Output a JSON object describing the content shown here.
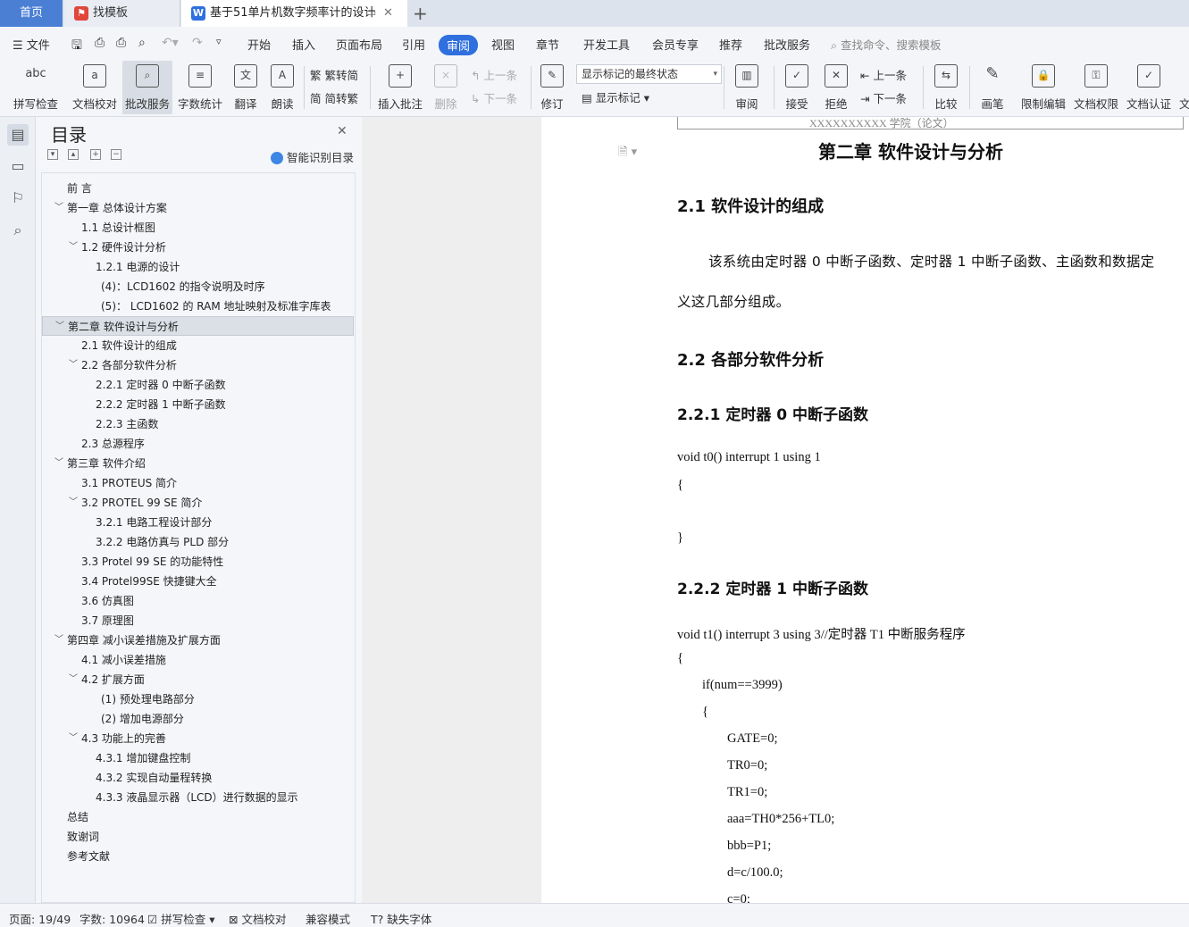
{
  "tabs": {
    "home": "首页",
    "template": "找模板",
    "document": "基于51单片机数字频率计的设计"
  },
  "menu": {
    "file": "文件",
    "items": [
      "开始",
      "插入",
      "页面布局",
      "引用",
      "审阅",
      "视图",
      "章节",
      "开发工具",
      "会员专享",
      "推荐",
      "批改服务"
    ],
    "active": "审阅",
    "search_placeholder": "查找命令、搜索模板"
  },
  "ribbon": {
    "spellcheck": "拼写检查",
    "doc_proof": "文档校对",
    "approval": "批改服务",
    "word_count": "字数统计",
    "translate": "翻译",
    "read_aloud": "朗读",
    "trad_conv": "繁转简",
    "simp_conv": "简转繁",
    "insert_comment": "插入批注",
    "delete": "删除",
    "prev": "上一条",
    "next": "下一条",
    "revise": "修订",
    "markup_state": "显示标记的最终状态",
    "show_markup": "显示标记",
    "review": "审阅",
    "accept": "接受",
    "reject": "拒绝",
    "prev2": "上一条",
    "next2": "下一条",
    "compare": "比较",
    "pen": "画笔",
    "restrict_edit": "限制编辑",
    "doc_perm": "文档权限",
    "doc_cert": "文档认证",
    "more": "文"
  },
  "toc": {
    "title": "目录",
    "smart": "智能识别目录",
    "items": [
      {
        "text": "前    言",
        "level": 0,
        "chevron": false
      },
      {
        "text": "第一章    总体设计方案",
        "level": 0,
        "chevron": true
      },
      {
        "text": "1.1  总设计框图",
        "level": 1,
        "chevron": false
      },
      {
        "text": "1.2   硬件设计分析",
        "level": 1,
        "chevron": true
      },
      {
        "text": "1.2.1  电源的设计",
        "level": 2,
        "chevron": false
      },
      {
        "text": "(4)：LCD1602 的指令说明及时序",
        "level": 3,
        "chevron": false
      },
      {
        "text": "(5)：   LCD1602 的 RAM 地址映射及标准字库表",
        "level": 3,
        "chevron": false
      },
      {
        "text": "第二章    软件设计与分析",
        "level": 0,
        "chevron": true,
        "selected": true
      },
      {
        "text": "2.1  软件设计的组成",
        "level": 1,
        "chevron": false
      },
      {
        "text": "2.2    各部分软件分析",
        "level": 1,
        "chevron": true
      },
      {
        "text": "2.2.1    定时器 0 中断子函数",
        "level": 2,
        "chevron": false
      },
      {
        "text": "2.2.2    定时器 1 中断子函数",
        "level": 2,
        "chevron": false
      },
      {
        "text": "2.2.3    主函数",
        "level": 2,
        "chevron": false
      },
      {
        "text": "2.3    总源程序",
        "level": 1,
        "chevron": false
      },
      {
        "text": "第三章    软件介绍",
        "level": 0,
        "chevron": true
      },
      {
        "text": "3.1 PROTEUS 简介",
        "level": 1,
        "chevron": false
      },
      {
        "text": "3.2 PROTEL 99 SE 简介",
        "level": 1,
        "chevron": true
      },
      {
        "text": "3.2.1  电路工程设计部分",
        "level": 2,
        "chevron": false
      },
      {
        "text": "3.2.2  电路仿真与 PLD 部分",
        "level": 2,
        "chevron": false
      },
      {
        "text": "3.3 Protel 99 SE 的功能特性",
        "level": 1,
        "chevron": false
      },
      {
        "text": "3.4 Protel99SE 快捷键大全",
        "level": 1,
        "chevron": false
      },
      {
        "text": "3.6 仿真图",
        "level": 1,
        "chevron": false
      },
      {
        "text": "3.7 原理图",
        "level": 1,
        "chevron": false
      },
      {
        "text": "第四章    减小误差措施及扩展方面",
        "level": 0,
        "chevron": true
      },
      {
        "text": "4.1 减小误差措施",
        "level": 1,
        "chevron": false
      },
      {
        "text": "4.2 扩展方面",
        "level": 1,
        "chevron": true
      },
      {
        "text": "(1)  预处理电路部分",
        "level": 3,
        "chevron": false
      },
      {
        "text": "(2)  增加电源部分",
        "level": 3,
        "chevron": false
      },
      {
        "text": "4.3  功能上的完善",
        "level": 1,
        "chevron": true
      },
      {
        "text": "4.3.1  增加键盘控制",
        "level": 2,
        "chevron": false
      },
      {
        "text": "4.3.2  实现自动量程转换",
        "level": 2,
        "chevron": false
      },
      {
        "text": "4.3.3  液晶显示器（LCD）进行数据的显示",
        "level": 2,
        "chevron": false
      },
      {
        "text": "总结",
        "level": 0,
        "chevron": false
      },
      {
        "text": "致谢词",
        "level": 0,
        "chevron": false
      },
      {
        "text": "参考文献",
        "level": 0,
        "chevron": false
      }
    ]
  },
  "page": {
    "header": "XXXXXXXXXX 学院（论文）",
    "chapter_title": "第二章    软件设计与分析",
    "sec21": "2.1  软件设计的组成",
    "para1": "该系统由定时器 0 中断子函数、定时器 1 中断子函数、主函数和数据定",
    "para2": "义这几部分组成。",
    "sec22": "2.2    各部分软件分析",
    "sec221": "2.2.1    定时器 0 中断子函数",
    "code1": [
      "void t0() interrupt 1 using 1",
      "{",
      "}"
    ],
    "sec222": "2.2.2    定时器 1 中断子函数",
    "code2": [
      "void t1() interrupt 3 using 3//定时器 T1 中断服务程序",
      "{",
      "if(num==3999)",
      "{",
      "GATE=0;",
      "TR0=0;",
      "TR1=0;",
      "aaa=TH0*256+TL0;",
      "bbb=P1;",
      "d=c/100.0;",
      "c=0;"
    ]
  },
  "status": {
    "page": "页面: 19/49",
    "words": "字数: 10964",
    "spell": "拼写检查",
    "proof": "文档校对",
    "compat": "兼容模式",
    "missing_font": "缺失字体"
  }
}
